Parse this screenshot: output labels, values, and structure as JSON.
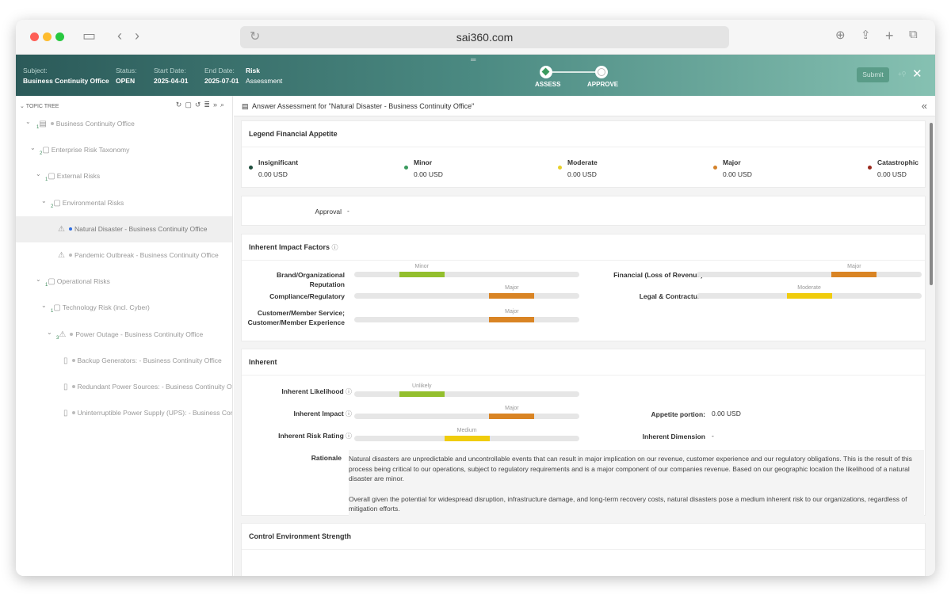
{
  "browser": {
    "url": "sai360.com"
  },
  "header": {
    "subject_label": "Subject:",
    "subject": "Business Continuity Office",
    "status_label": "Status:",
    "status": "OPEN",
    "start_label": "Start Date:",
    "start": "2025-04-01",
    "end_label": "End Date:",
    "end": "2025-07-01",
    "type_line1": "Risk",
    "type_line2": "Assessment",
    "steps": [
      "ASSESS",
      "APPROVE"
    ],
    "submit": "Submit"
  },
  "sidebar": {
    "title": "TOPIC TREE",
    "items": [
      {
        "label": "Business Continuity Office",
        "num": "1"
      },
      {
        "label": "Enterprise Risk Taxonomy",
        "num": "2"
      },
      {
        "label": "External Risks",
        "num": "1"
      },
      {
        "label": "Environmental Risks",
        "num": "2"
      },
      {
        "label": "Natural Disaster - Business Continuity Office",
        "num": ""
      },
      {
        "label": "Pandemic Outbreak - Business Continuity Office",
        "num": ""
      },
      {
        "label": "Operational Risks",
        "num": "1"
      },
      {
        "label": "Technology Risk (incl. Cyber)",
        "num": "1"
      },
      {
        "label": "Power Outage - Business Continuity Office",
        "num": "3"
      },
      {
        "label": "Backup Generators: - Business Continuity Office",
        "num": ""
      },
      {
        "label": "Redundant Power Sources: - Business Continuity Office",
        "num": ""
      },
      {
        "label": "Uninterruptible Power Supply (UPS): - Business Continuity Office",
        "num": ""
      }
    ]
  },
  "main": {
    "title": "Answer Assessment for \"Natural Disaster - Business Continuity Office\"",
    "legend": {
      "title": "Legend Financial Appetite",
      "items": [
        {
          "name": "Insignificant",
          "value": "0.00 USD",
          "color": "#1e4d3c"
        },
        {
          "name": "Minor",
          "value": "0.00 USD",
          "color": "#3a9a5e"
        },
        {
          "name": "Moderate",
          "value": "0.00 USD",
          "color": "#e8d02a"
        },
        {
          "name": "Major",
          "value": "0.00 USD",
          "color": "#d4822a"
        },
        {
          "name": "Catastrophic",
          "value": "0.00 USD",
          "color": "#9a2a1e"
        }
      ]
    },
    "approval": {
      "label": "Approval",
      "value": "-"
    },
    "impact": {
      "title": "Inherent Impact Factors",
      "factors": [
        {
          "label": "Brand/Organizational Reputation",
          "level": "Minor",
          "index": 1,
          "color": "#93bf2d"
        },
        {
          "label": "Compliance/Regulatory",
          "level": "Major",
          "index": 3,
          "color": "#d98424"
        },
        {
          "label": "Customer/Member Service; Customer/Member Experience",
          "level": "Major",
          "index": 3,
          "color": "#d98424"
        },
        {
          "label": "Financial (Loss of Revenue)",
          "level": "Major",
          "index": 3,
          "color": "#d98424"
        },
        {
          "label": "Legal & Contractual",
          "level": "Moderate",
          "index": 2,
          "color": "#f0cc0c"
        }
      ]
    },
    "inherent": {
      "title": "Inherent",
      "rows": [
        {
          "label": "Inherent Likelihood",
          "level": "Unlikely",
          "index": 1,
          "color": "#93bf2d"
        },
        {
          "label": "Inherent Impact",
          "level": "Major",
          "index": 3,
          "color": "#d98424"
        },
        {
          "label": "Inherent Risk Rating",
          "level": "Medium",
          "index": 2,
          "color": "#f0cc0c"
        }
      ],
      "appetite_label": "Appetite portion:",
      "appetite_value": "0.00 USD",
      "dimension_label": "Inherent Dimension",
      "dimension_value": "-",
      "rationale_label": "Rationale",
      "rationale_p1": "Natural disasters are unpredictable and uncontrollable events that can result in major implication on our revenue, customer experience and our regulatory obligations. This is the result of this process being critical to our operations, subject to regulatory requirements and is a major component of our companies revenue. Based on our geographic location the likelihood of a natural disaster are minor.",
      "rationale_p2": "Overall given the potential for widespread disruption, infrastructure damage, and long-term recovery costs, natural disasters pose a medium inherent risk to our organizations, regardless of mitigation efforts."
    },
    "control": {
      "title": "Control Environment Strength"
    }
  }
}
